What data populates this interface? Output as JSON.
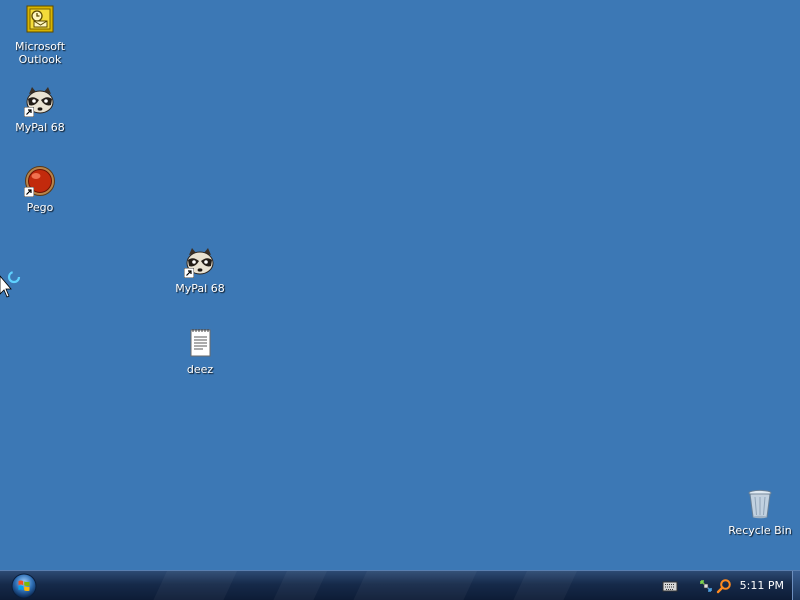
{
  "desktop": {
    "background_color": "#3c78b5",
    "icons": [
      {
        "label": "Microsoft\nOutlook",
        "icon": "outlook-icon",
        "shortcut": false
      },
      {
        "label": "MyPal 68",
        "icon": "mypal-raccoon-icon",
        "shortcut": true
      },
      {
        "label": "Pego",
        "icon": "pego-red-ball-icon",
        "shortcut": true
      },
      {
        "label": "MyPal 68",
        "icon": "mypal-raccoon-icon",
        "shortcut": true
      },
      {
        "label": "deez",
        "icon": "text-document-icon",
        "shortcut": false
      },
      {
        "label": "Recycle Bin",
        "icon": "recycle-bin-icon",
        "shortcut": false
      }
    ]
  },
  "taskbar": {
    "start_icon": "windows-orb-icon",
    "tray": {
      "icons": [
        "keyboard-icon",
        "network-icon",
        "search-icon"
      ],
      "clock": "5:11 PM"
    }
  },
  "cursor": {
    "icon": "busy-pointer-icon"
  }
}
